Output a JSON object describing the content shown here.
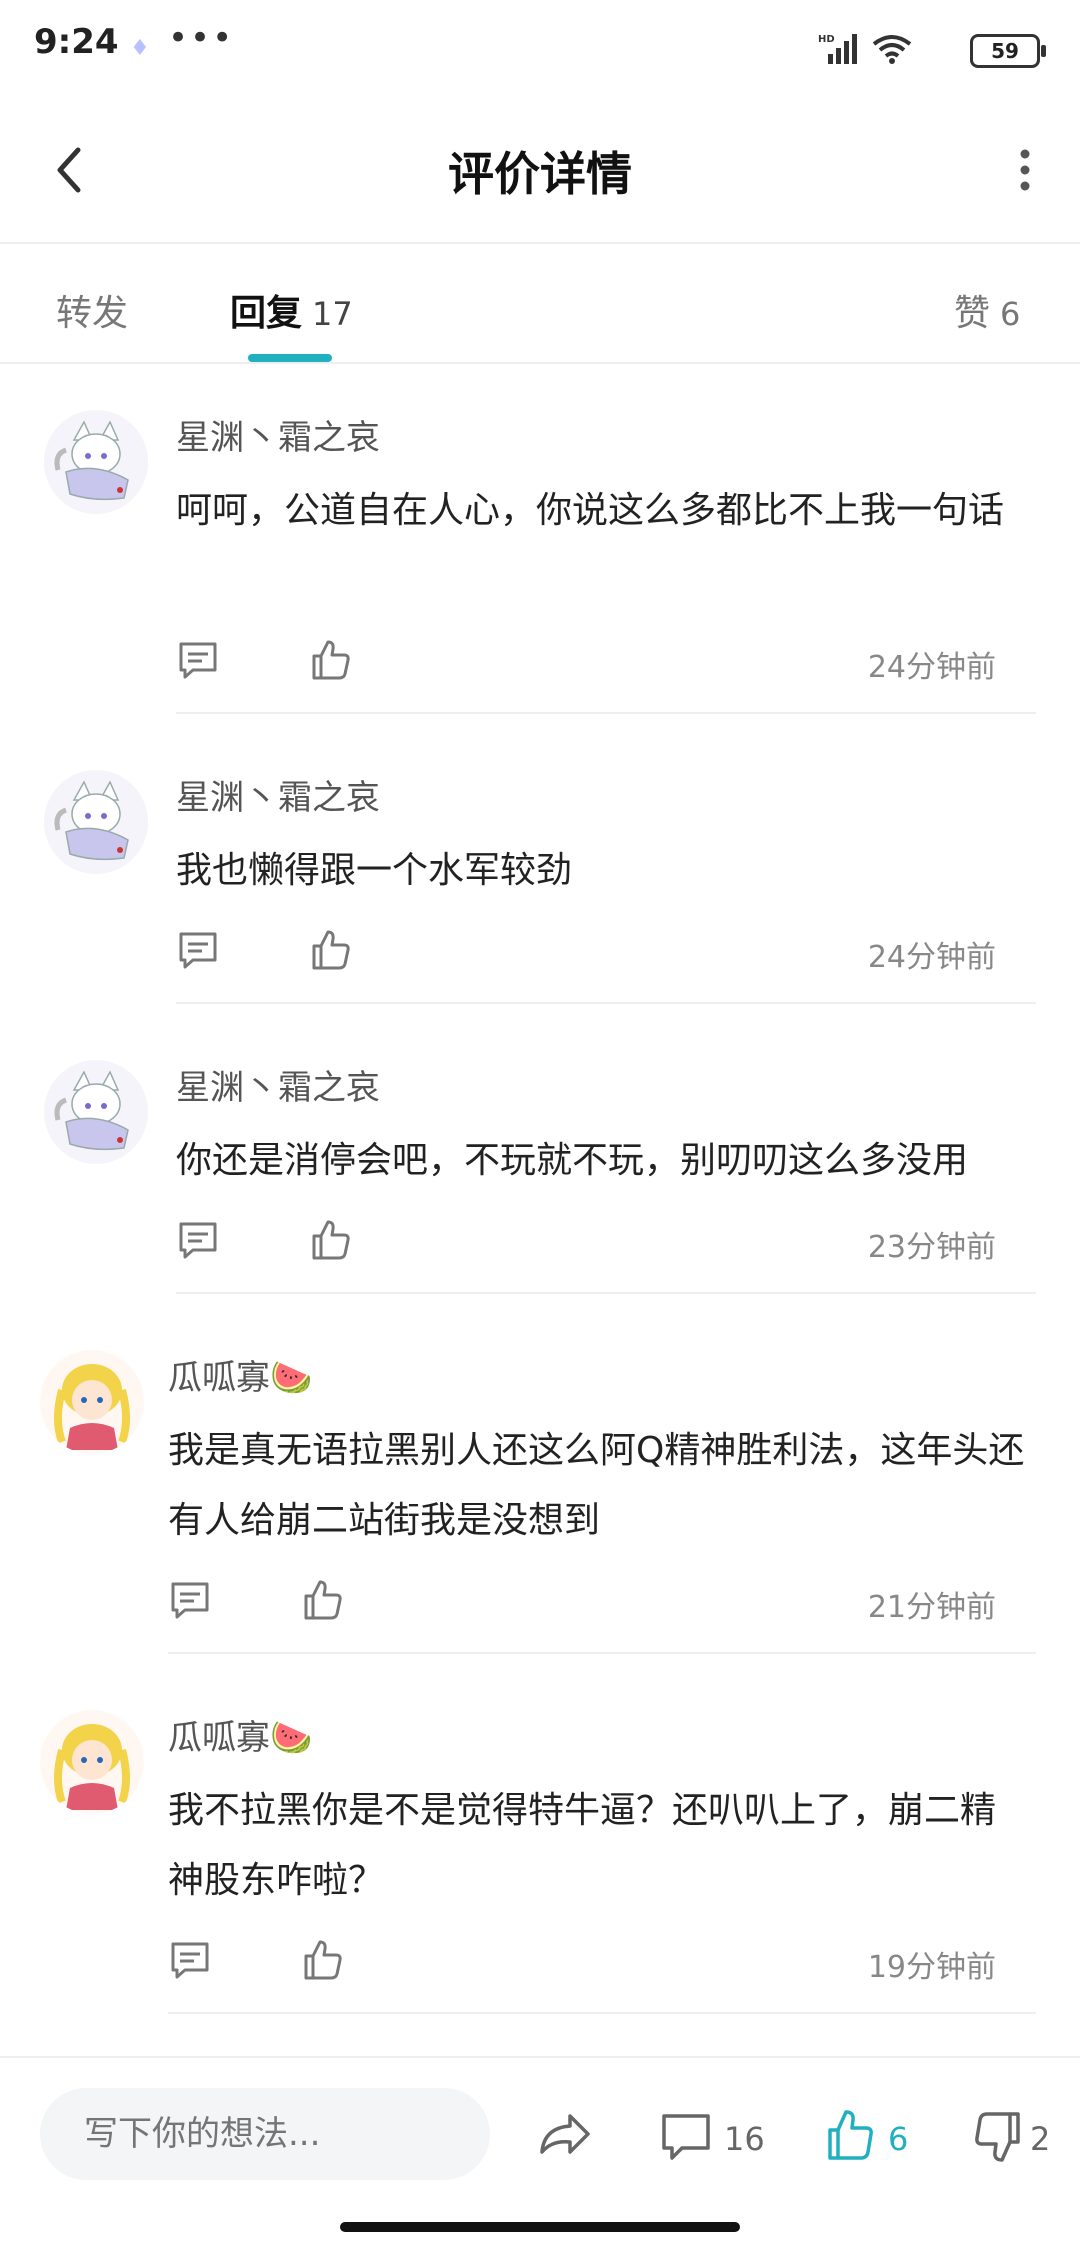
{
  "statusbar": {
    "time": "9:24",
    "more": "•••",
    "battery": "59"
  },
  "header": {
    "title": "评价详情",
    "back_icon": "chevron-left-icon",
    "menu_icon": "more-vertical-icon"
  },
  "tabs": [
    {
      "label": "转发",
      "count": ""
    },
    {
      "label": "回复",
      "count": "17",
      "active": true
    },
    {
      "label": "赞",
      "count": "6"
    }
  ],
  "accent_color": "#20b0c0",
  "comments": [
    {
      "user": "星渊丶霜之哀",
      "avatar": "fox-girl-avatar",
      "text": "呵呵，公道自在人心，你说这么多都比不上我一句话",
      "time": "24分钟前"
    },
    {
      "user": "星渊丶霜之哀",
      "avatar": "fox-girl-avatar",
      "text": "我也懒得跟一个水军较劲",
      "time": "24分钟前"
    },
    {
      "user": "星渊丶霜之哀",
      "avatar": "fox-girl-avatar",
      "text": "你还是消停会吧，不玩就不玩，别叨叨这么多没用",
      "time": "23分钟前"
    },
    {
      "user": "瓜呱寡🍉",
      "avatar": "sailor-girl-avatar",
      "text": "我是真无语拉黑别人还这么阿Q精神胜利法，这年头还有人给崩二站街我是没想到",
      "time": "21分钟前"
    },
    {
      "user": "瓜呱寡🍉",
      "avatar": "sailor-girl-avatar",
      "text": "我不拉黑你是不是觉得特牛逼？还叭叭上了，崩二精神股东咋啦？",
      "time": "19分钟前"
    }
  ],
  "bottombar": {
    "placeholder": "写下你的想法...",
    "comment_count": "16",
    "like_count": "6",
    "dislike_count": "2"
  }
}
